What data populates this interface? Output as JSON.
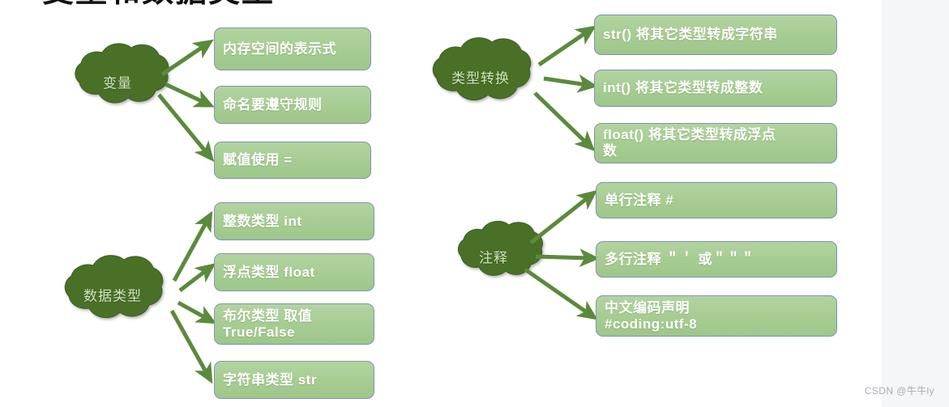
{
  "slide": {
    "title": "变量和数据类型",
    "watermark": "CSDN @牛牛ly"
  },
  "palette": {
    "cloud_fill": "#4a7028",
    "cloud_text": "#cfe5bb",
    "box_fill": "#a9cf96",
    "box_border": "#8094ad",
    "box_text": "#ffffff",
    "arrow": "#5b8a3c",
    "page_margin": "#f4f6fa",
    "background": "#ffffff"
  },
  "branches": [
    {
      "id": "variable",
      "hub_label": "变量",
      "leaves": [
        {
          "label": "内存空间的表示式"
        },
        {
          "label": "命名要遵守规则"
        },
        {
          "label": "赋值使用  ="
        }
      ]
    },
    {
      "id": "data-type",
      "hub_label": "数据类型",
      "leaves": [
        {
          "label": "整数类型  int"
        },
        {
          "label": "浮点类型  float"
        },
        {
          "label": "布尔类型 取值\nTrue/False"
        },
        {
          "label": "字符串类型  str"
        }
      ]
    },
    {
      "id": "type-conversion",
      "hub_label": "类型转换",
      "leaves": [
        {
          "label": "str() 将其它类型转成字符串"
        },
        {
          "label": "int() 将其它类型转成整数"
        },
        {
          "label": "float() 将其它类型转成浮点\n数"
        }
      ]
    },
    {
      "id": "comment",
      "hub_label": "注释",
      "leaves": [
        {
          "label": "单行注释   #"
        },
        {
          "label": "多行注释   ＂＇      或＂＂＂"
        },
        {
          "label": "中文编码声明\n#coding:utf-8"
        }
      ]
    }
  ]
}
